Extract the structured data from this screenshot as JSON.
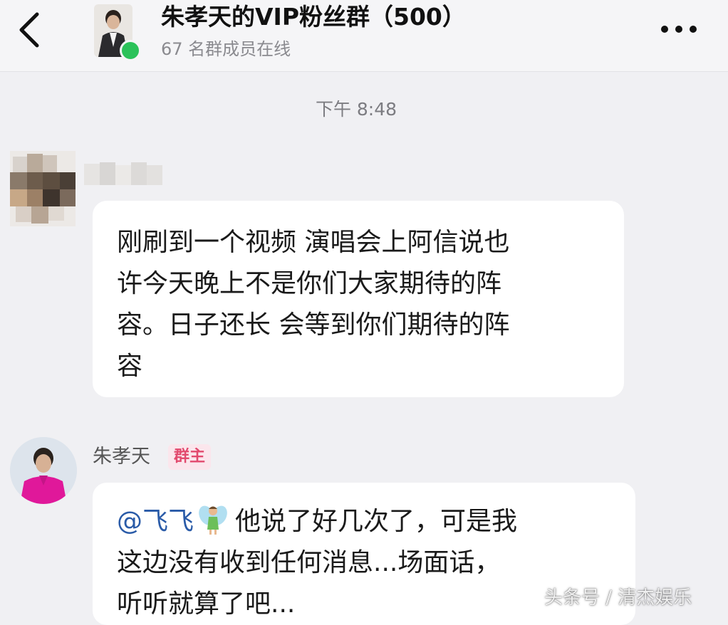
{
  "header": {
    "title": "朱孝天的VIP粉丝群（500）",
    "subtitle": "67 名群成员在线",
    "back_icon": "chevron-left-icon",
    "more_icon": "more-horizontal-icon"
  },
  "chat": {
    "timestamp": "下午 8:48",
    "messages": [
      {
        "sender": "",
        "lines": [
          "刚刷到一个视频 演唱会上阿信说也",
          "许今天晚上不是你们大家期待的阵",
          "容。日子还长 会等到你们期待的阵",
          "容"
        ]
      },
      {
        "sender": "朱孝天",
        "badge": "群主",
        "mention": "@飞飞",
        "line1_rest": "他说了好几次了，可是我",
        "lines": [
          "这边没有收到任何消息...场面话，",
          "听听就算了吧..."
        ]
      }
    ]
  },
  "watermark": "头条号 / 清杰娱乐",
  "colors": {
    "background": "#f0f0f3",
    "online": "#2bc25a",
    "mention": "#2a5ba8",
    "badge_text": "#e24a6e",
    "badge_bg": "#fbe6ec"
  }
}
